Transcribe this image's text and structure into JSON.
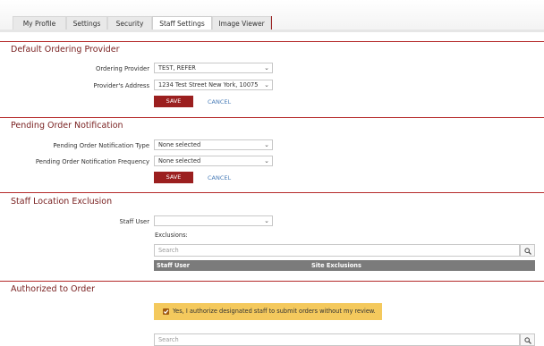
{
  "tabs": [
    {
      "label": "My Profile",
      "active": false
    },
    {
      "label": "Settings",
      "active": false
    },
    {
      "label": "Security",
      "active": false
    },
    {
      "label": "Staff Settings",
      "active": true
    },
    {
      "label": "Image Viewer",
      "active": false
    }
  ],
  "default_provider": {
    "title": "Default Ordering Provider",
    "ordering_provider_label": "Ordering Provider",
    "ordering_provider_value": "TEST, REFER",
    "address_label": "Provider's Address",
    "address_value": "1234 Test Street New York, 10075",
    "save_label": "SAVE",
    "cancel_label": "CANCEL"
  },
  "pending_notification": {
    "title": "Pending Order Notification",
    "type_label": "Pending Order Notification Type",
    "type_value": "None selected",
    "frequency_label": "Pending Order Notification Frequency",
    "frequency_value": "None selected",
    "save_label": "SAVE",
    "cancel_label": "CANCEL"
  },
  "staff_location": {
    "title": "Staff Location Exclusion",
    "staff_user_label": "Staff User",
    "staff_user_value": "",
    "exclusions_label": "Exclusions:",
    "search_placeholder": "Search",
    "columns": [
      "Staff User",
      "Site Exclusions"
    ]
  },
  "authorized": {
    "title": "Authorized to Order",
    "checkbox_checked": true,
    "checkbox_text": "Yes, I authorize designated staff to submit orders without my review.",
    "search_placeholder": "Search"
  },
  "colors": {
    "accent": "#9b1f1f",
    "section_title": "#7a2222",
    "link": "#4a7db8",
    "auth_highlight": "#f4c95d",
    "table_header": "#7b7b7b"
  }
}
